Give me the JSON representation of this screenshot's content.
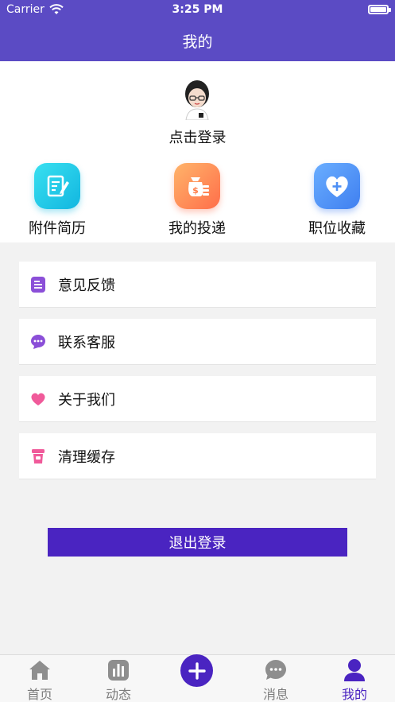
{
  "status_bar": {
    "carrier": "Carrier",
    "time": "3:25 PM"
  },
  "nav": {
    "title": "我的"
  },
  "profile": {
    "login_text": "点击登录"
  },
  "quick_actions": [
    {
      "label": "附件简历",
      "icon": "resume-icon",
      "color": "#1ec7e6"
    },
    {
      "label": "我的投递",
      "icon": "money-bag-icon",
      "color": "#ff9a4a"
    },
    {
      "label": "职位收藏",
      "icon": "heart-plus-icon",
      "color": "#4d8ff5"
    }
  ],
  "menu": [
    {
      "label": "意见反馈",
      "icon": "feedback-icon",
      "color": "#8b4fd8"
    },
    {
      "label": "联系客服",
      "icon": "chat-icon",
      "color": "#8b4fd8"
    },
    {
      "label": "关于我们",
      "icon": "heart-icon",
      "color": "#f05a9a"
    },
    {
      "label": "清理缓存",
      "icon": "trash-icon",
      "color": "#f05a9a"
    }
  ],
  "logout_label": "退出登录",
  "tabs": [
    {
      "label": "首页",
      "icon": "home-icon"
    },
    {
      "label": "动态",
      "icon": "chart-icon"
    },
    {
      "label": "消息",
      "icon": "message-icon"
    },
    {
      "label": "我的",
      "icon": "user-icon",
      "active": true
    }
  ],
  "colors": {
    "header": "#5b4bc4",
    "accent": "#4a24c1",
    "background": "#f2f2f2"
  }
}
